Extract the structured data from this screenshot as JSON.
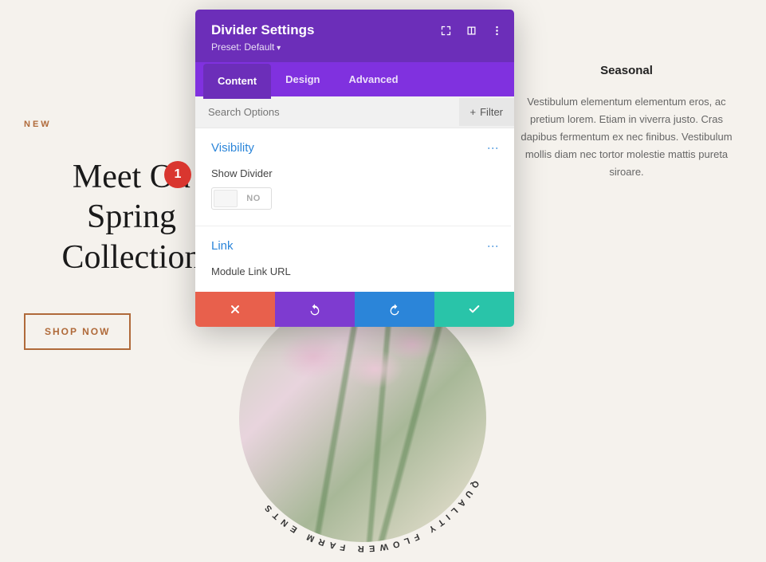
{
  "background": {
    "new_label": "NEW",
    "headline_l1": "Meet Ou",
    "headline_l2": "Spring",
    "headline_l3": "Collection",
    "shop_button": "SHOP NOW",
    "circle_text": "QUALITY FLOWER FARM   ENTS",
    "seasonal_heading": "Seasonal",
    "seasonal_body": "Vestibulum elementum elementum eros, ac pretium lorem. Etiam in viverra justo. Cras dapibus fermentum ex nec finibus. Vestibulum mollis diam nec tortor molestie mattis pureta siroare."
  },
  "modal": {
    "title": "Divider Settings",
    "preset": "Preset: Default",
    "tabs": {
      "content": "Content",
      "design": "Design",
      "advanced": "Advanced"
    },
    "search_placeholder": "Search Options",
    "filter_label": "Filter",
    "sections": {
      "visibility": {
        "heading": "Visibility",
        "field_label": "Show Divider",
        "toggle_value": "NO"
      },
      "link": {
        "heading": "Link",
        "field_label": "Module Link URL"
      }
    }
  },
  "callout": {
    "num": "1"
  }
}
